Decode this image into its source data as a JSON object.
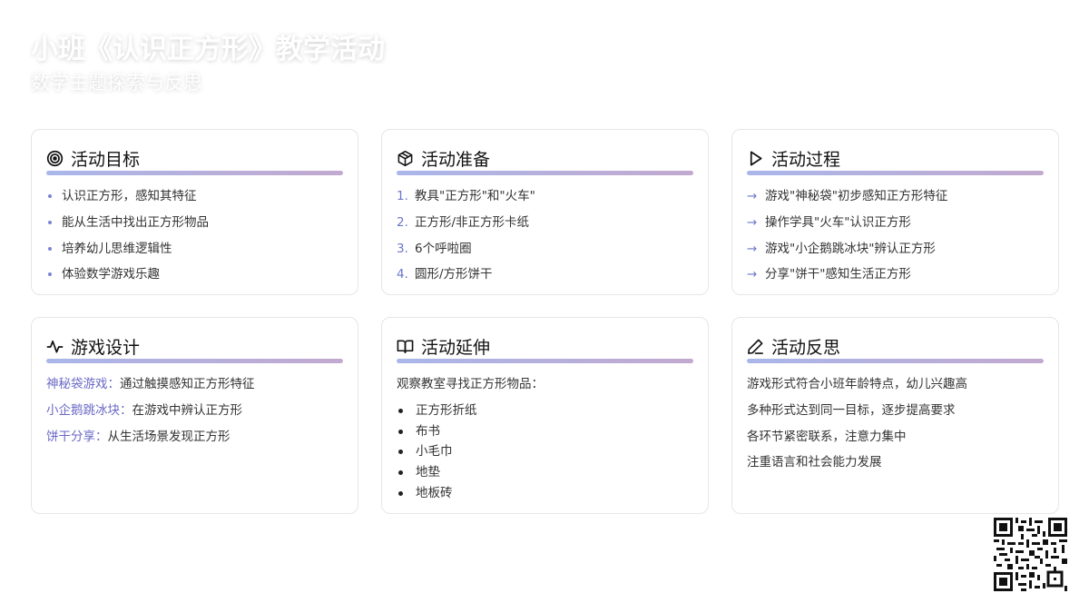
{
  "header": {
    "title": "小班《认识正方形》教学活动",
    "subtitle": "数学主题探索与反思"
  },
  "cards": {
    "goals": {
      "icon": "target-icon",
      "title": "活动目标",
      "items": [
        "认识正方形，感知其特征",
        "能从生活中找出正方形物品",
        "培养幼儿思维逻辑性",
        "体验数学游戏乐趣"
      ]
    },
    "prep": {
      "icon": "box-icon",
      "title": "活动准备",
      "items": [
        {
          "num": "1.",
          "text": "教具\"正方形\"和\"火车\""
        },
        {
          "num": "2.",
          "text": "正方形/非正方形卡纸"
        },
        {
          "num": "3.",
          "text": "6个呼啦圈"
        },
        {
          "num": "4.",
          "text": "圆形/方形饼干"
        }
      ]
    },
    "process": {
      "icon": "play-icon",
      "title": "活动过程",
      "arrow": "→",
      "items": [
        "游戏\"神秘袋\"初步感知正方形特征",
        "操作学具\"火车\"认识正方形",
        "游戏\"小企鹅跳冰块\"辨认正方形",
        "分享\"饼干\"感知生活正方形"
      ]
    },
    "game": {
      "icon": "activity-icon",
      "title": "游戏设计",
      "items": [
        {
          "key": "神秘袋游戏：",
          "text": "通过触摸感知正方形特征"
        },
        {
          "key": "小企鹅跳冰块：",
          "text": "在游戏中辨认正方形"
        },
        {
          "key": "饼干分享：",
          "text": "从生活场景发现正方形"
        }
      ]
    },
    "extension": {
      "icon": "book-icon",
      "title": "活动延伸",
      "intro": "观察教室寻找正方形物品：",
      "items": [
        "正方形折纸",
        "布书",
        "小毛巾",
        "地垫",
        "地板砖"
      ]
    },
    "reflection": {
      "icon": "pencil-icon",
      "title": "活动反思",
      "items": [
        "游戏形式符合小班年龄特点，幼儿兴趣高",
        "多种形式达到同一目标，逐步提高要求",
        "各环节紧密联系，注意力集中",
        "注重语言和社会能力发展"
      ]
    }
  },
  "colors": {
    "accent": "#6b76c9",
    "bar_start": "#aab6ea",
    "bar_end": "#c2a9cf",
    "card_border": "#e6e6ea"
  }
}
